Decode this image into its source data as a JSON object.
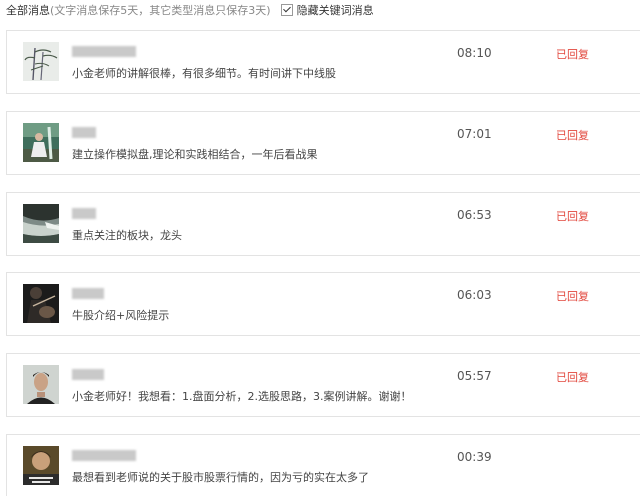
{
  "header": {
    "title": "全部消息",
    "note": "(文字消息保存5天，其它类型消息只保存3天)",
    "hide_keyword_label": "隐藏关键词消息",
    "hide_keyword_checked": true
  },
  "messages": [
    {
      "avatar": "avatar-bamboo-painting",
      "message": "小金老师的讲解很棒，有很多细节。有时间讲下中线股",
      "time": "08:10",
      "status": "已回复"
    },
    {
      "avatar": "avatar-person-waterfall",
      "message": "建立操作模拟盘,理论和实践相结合，一年后看战果",
      "time": "07:01",
      "status": "已回复"
    },
    {
      "avatar": "avatar-river-landscape",
      "message": "重点关注的板块，龙头",
      "time": "06:53",
      "status": "已回复"
    },
    {
      "avatar": "avatar-dark-guitar",
      "message": "牛股介绍+风险提示",
      "time": "06:03",
      "status": "已回复"
    },
    {
      "avatar": "avatar-man-portrait",
      "message": "小金老师好！我想看：1.盘面分析，2.选股思路，3.案例讲解。谢谢！",
      "time": "05:57",
      "status": "已回复"
    },
    {
      "avatar": "avatar-child-photo",
      "message": "最想看到老师说的关于股市股票行情的，因为亏的实在太多了",
      "time": "00:39",
      "status": ""
    }
  ]
}
